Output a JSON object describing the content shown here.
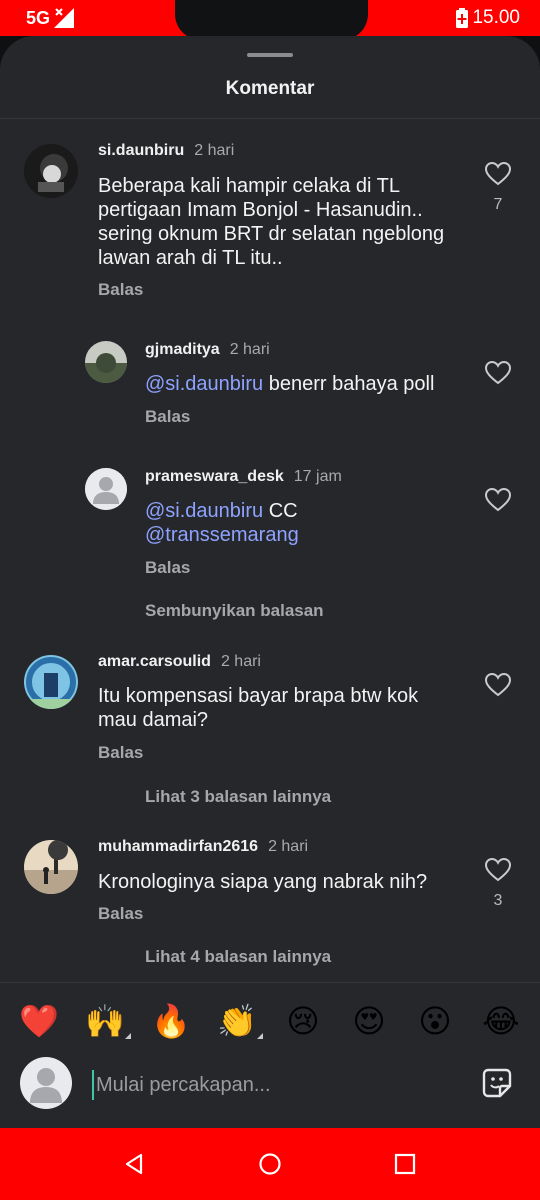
{
  "status_bar": {
    "network": "5G",
    "time": "15.00"
  },
  "sheet": {
    "title": "Komentar"
  },
  "comments": [
    {
      "username": "si.daunbiru",
      "time": "2 hari",
      "text": "Beberapa kali hampir celaka di TL pertigaan Imam Bonjol - Hasanudin.. sering oknum BRT dr selatan ngeblong lawan arah di TL itu..",
      "reply_label": "Balas",
      "likes": "7"
    },
    {
      "username": "gjmaditya",
      "time": "2 hari",
      "mention": "@si.daunbiru",
      "text": " benerr bahaya poll",
      "reply_label": "Balas"
    },
    {
      "username": "prameswara_desk",
      "time": "17 jam",
      "mention": "@si.daunbiru",
      "text": " CC",
      "mention2": "@transsemarang",
      "reply_label": "Balas"
    },
    {
      "username": "amar.carsoulid",
      "time": "2 hari",
      "text": "Itu kompensasi bayar brapa btw kok mau damai?",
      "reply_label": "Balas"
    },
    {
      "username": "muhammadirfan2616",
      "time": "2 hari",
      "text": "Kronologinya siapa yang nabrak nih?",
      "reply_label": "Balas",
      "likes": "3"
    }
  ],
  "thread_actions": {
    "hide_replies": "Sembunyikan balasan",
    "more_replies_1": "Lihat 3 balasan lainnya",
    "more_replies_2": "Lihat 4 balasan lainnya"
  },
  "emoji_bar": [
    "❤️",
    "🙌",
    "🔥",
    "👏",
    "😢",
    "😍",
    "😮",
    "😂"
  ],
  "composer": {
    "placeholder": "Mulai percakapan..."
  },
  "icons": {
    "like": "heart-outline-icon",
    "sticker": "sticker-icon",
    "nav": [
      "back-icon",
      "home-icon",
      "recents-icon"
    ]
  },
  "colors": {
    "accent_mention": "#8ea2ff",
    "status_bar": "#ff0000",
    "sheet_bg": "#25272b"
  }
}
